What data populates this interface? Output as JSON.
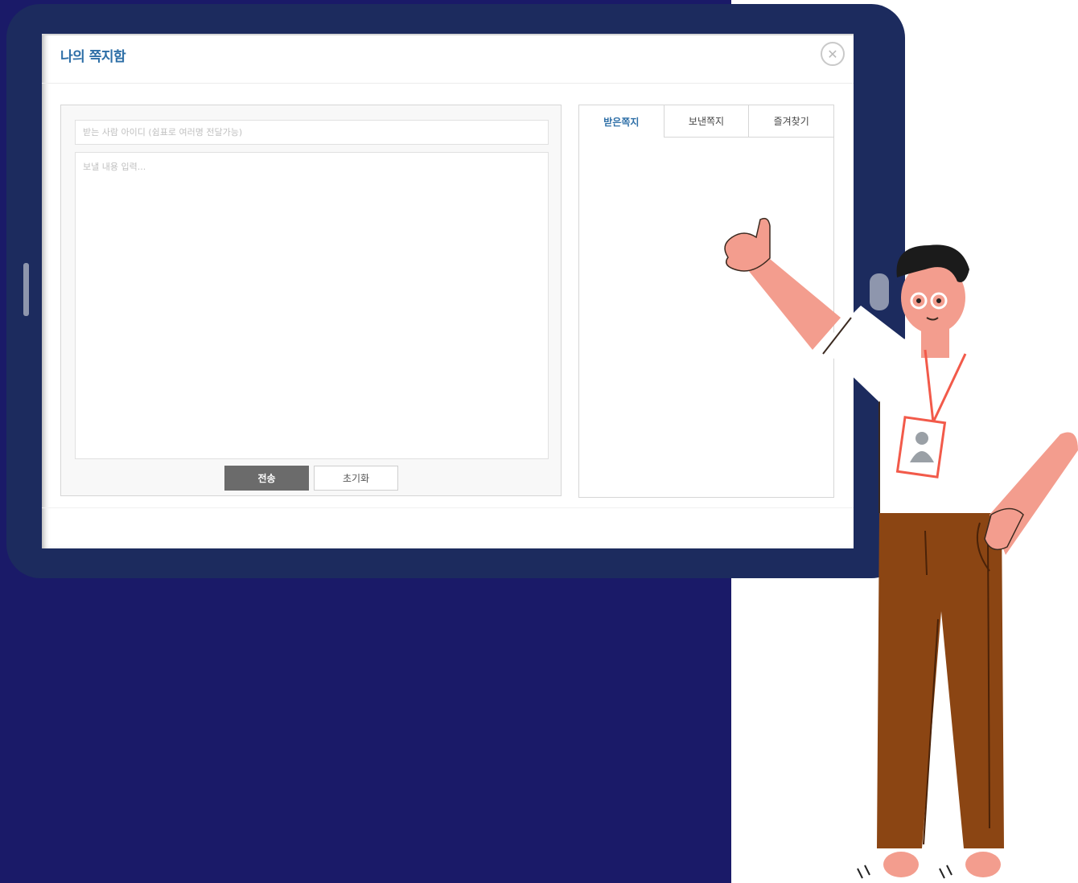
{
  "window": {
    "title": "나의 쪽지함"
  },
  "compose": {
    "recipient_placeholder": "받는 사람 아이디 (쉼표로 여러명 전달가능)",
    "recipient_value": "",
    "message_placeholder": "보낼 내용 입력...",
    "message_value": "",
    "send_label": "전송",
    "reset_label": "초기화"
  },
  "tabs": [
    {
      "label": "받은쪽지",
      "active": true
    },
    {
      "label": "보낸쪽지",
      "active": false
    },
    {
      "label": "즐겨찾기",
      "active": false
    }
  ],
  "colors": {
    "background_navy": "#1a1a68",
    "tablet_frame": "#1c2b5e",
    "accent_blue": "#2e6fa7",
    "send_button": "#6b6b6b"
  },
  "icons": {
    "close": "close-icon"
  }
}
